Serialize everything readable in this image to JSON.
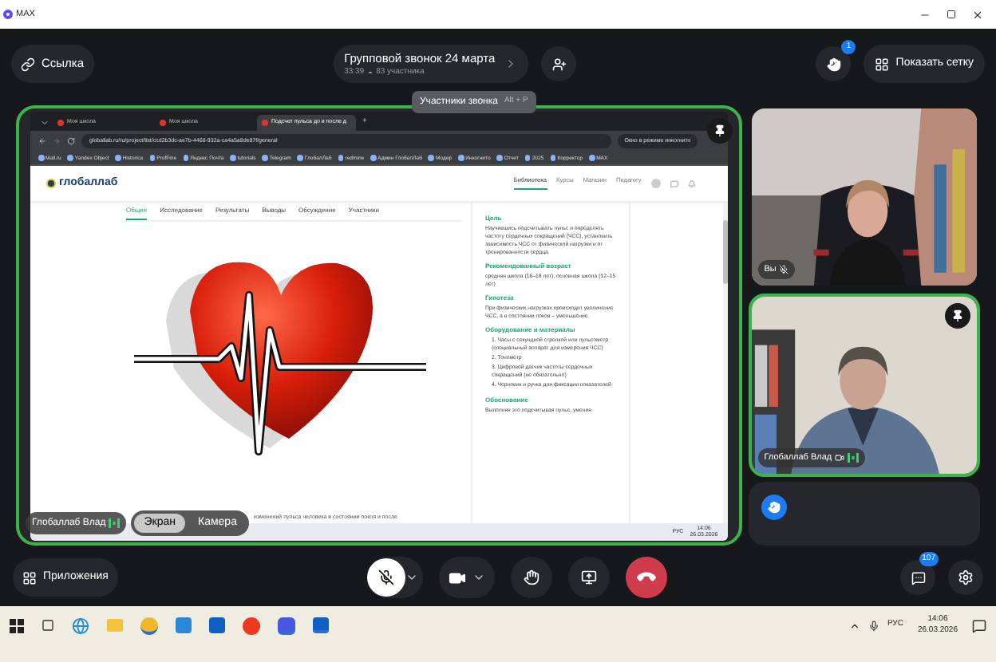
{
  "window": {
    "app_name": "MAX"
  },
  "top_bar": {
    "link_button": "Ссылка",
    "call": {
      "title": "Групповой звонок 24 марта",
      "duration": "33:39",
      "participants": "83 участника"
    },
    "hand_badge": "1",
    "grid_button": "Показать сетку",
    "tooltip": {
      "label": "Участники звонка",
      "shortcut": "Alt + P"
    }
  },
  "shared_screen": {
    "browser": {
      "tabs": [
        {
          "label": "Моя школа",
          "selected": false
        },
        {
          "label": "Моя школа",
          "selected": false
        },
        {
          "label": "Подсчет пульса до и после д",
          "selected": true
        }
      ],
      "new_tab": "+",
      "url": "globallab.ru/ru/project/list/ccd2b3dc-ae7b-4468-932a-ca4a5a8de87f/general",
      "incognito": "Окно в режиме инкогнито",
      "bookmarks": [
        "Mail.ru",
        "Yandex Object",
        "Historica",
        "ProfFine",
        "Яндекс Почта",
        "tutorials",
        "Telegram",
        "ГлобалЛаб",
        "redmine",
        "Админ ГлобалЛаб",
        "Модер",
        "Инкогнито",
        "Отчет",
        "2025",
        "Корректор",
        "MAX"
      ]
    },
    "site": {
      "logo": "глобаллаб",
      "nav": [
        {
          "label": "Библиотека",
          "selected": true
        },
        {
          "label": "Курсы",
          "selected": false
        },
        {
          "label": "Магазин",
          "selected": false
        },
        {
          "label": "Педагогу",
          "selected": false
        }
      ],
      "tabs": [
        {
          "label": "Общее",
          "selected": true
        },
        {
          "label": "Исследование",
          "selected": false
        },
        {
          "label": "Результаты",
          "selected": false
        },
        {
          "label": "Выводы",
          "selected": false
        },
        {
          "label": "Обсуждение",
          "selected": false
        },
        {
          "label": "Участники",
          "selected": false
        }
      ],
      "sections": [
        {
          "heading": "Цель",
          "text": "Научившись подсчитывать пульс и определять частоту сердечных сокращений (ЧСС), установить зависимость ЧСС от физической нагрузки и от тренированности сердца."
        },
        {
          "heading": "Рекомендованный возраст",
          "text": "средняя школа (16–18 лет), основная школа (12–15 лет)"
        },
        {
          "heading": "Гипотеза",
          "text": "При физических нагрузках происходит увеличение ЧСС, а в состоянии покоя – уменьшение."
        },
        {
          "heading": "Оборудование и материалы",
          "items": [
            "1. Часы с секундной стрелкой или пульсометр (специальный аппарат для измерения ЧСС)",
            "2. Тонометр",
            "3. Цифровой датчик частоты сердечных сокращений (не обязательно)",
            "4. Черновик и ручка для фиксации показателей"
          ]
        },
        {
          "heading": "Обоснование",
          "text": "Выполняя это подсчитывая пульс, умения"
        }
      ],
      "bottom_text": "изменений пульса человека в состоянии покоя и после"
    },
    "os_taskbar": {
      "lang": "РУС",
      "time": "14:06",
      "date": "26.03.2026"
    },
    "presenter": "Глобаллаб Влад",
    "view_toggle": [
      {
        "label": "Экран",
        "selected": true
      },
      {
        "label": "Камера",
        "selected": false
      }
    ]
  },
  "participants": [
    {
      "name": "Вы",
      "muted": true,
      "pinned": false,
      "speaking": false
    },
    {
      "name": "Глобаллаб Влад",
      "muted": false,
      "pinned": true,
      "speaking": true
    }
  ],
  "controls": {
    "apps_button": "Приложения",
    "mic_muted": true,
    "chat_badge": "107"
  },
  "taskbar": {
    "lang": "РУС",
    "time": "14:06",
    "date": "26.03.2026"
  }
}
